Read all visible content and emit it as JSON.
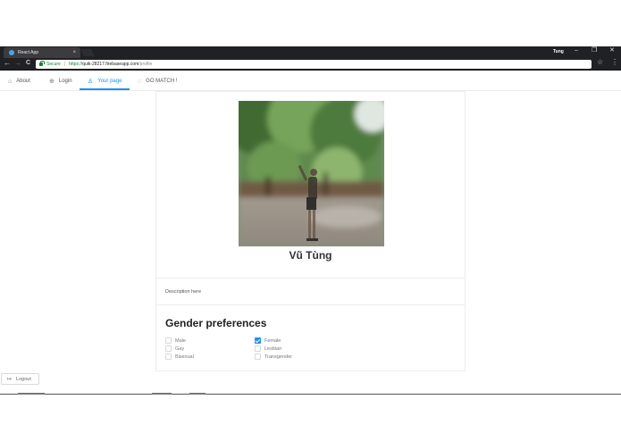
{
  "browser": {
    "tab_title": "React App",
    "tab_close": "×",
    "profile_name": "Tung",
    "window_controls": {
      "minimize": "–",
      "restore": "❐",
      "close": "✕"
    },
    "nav": {
      "back": "←",
      "forward": "→",
      "reload": "C"
    },
    "secure_label": "Secure",
    "url_scheme": "https://",
    "url_host": "quik-28217.firebaseapp.com",
    "url_path": "/profile",
    "bookmark_icon": "☆",
    "menu_icon": "⋮"
  },
  "nav": {
    "items": [
      {
        "label": "About",
        "icon": "home-icon",
        "glyph": "⌂"
      },
      {
        "label": "Login",
        "icon": "login-icon",
        "glyph": "⊕"
      },
      {
        "label": "Your page",
        "icon": "user-icon",
        "glyph": "♙"
      },
      {
        "label": "GO MATCH !",
        "icon": "chat-icon",
        "glyph": "◌"
      }
    ],
    "active": "Your page",
    "accent_color": "#1890ff"
  },
  "profile": {
    "name": "Vũ Tùng",
    "description": "Description here"
  },
  "gender_preferences": {
    "title": "Gender preferences",
    "options": [
      {
        "label": "Male",
        "checked": false
      },
      {
        "label": "Female",
        "checked": true
      },
      {
        "label": "Gay",
        "checked": false
      },
      {
        "label": "Lesbian",
        "checked": false
      },
      {
        "label": "Bisexual",
        "checked": false
      },
      {
        "label": "Transgender",
        "checked": false
      }
    ]
  },
  "logout": {
    "label": "Logout",
    "icon": "logout-icon",
    "glyph": "↦"
  }
}
